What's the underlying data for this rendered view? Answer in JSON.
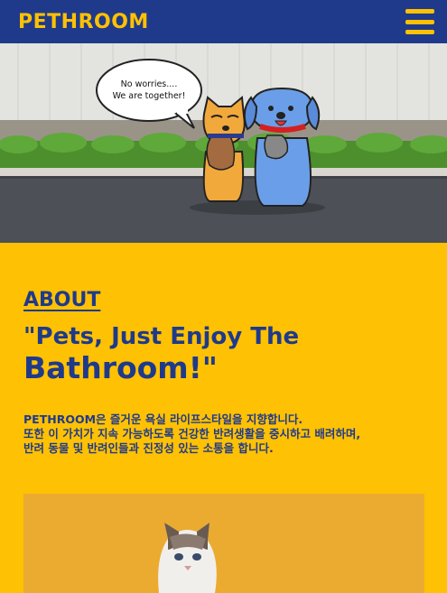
{
  "header": {
    "logo": "PETHROOM"
  },
  "hero": {
    "speech_line1": "No worries....",
    "speech_line2": "We are together!"
  },
  "about": {
    "title": "ABOUT",
    "heading_line1": "\"Pets, Just Enjoy The",
    "heading_line2": "Bathroom!\"",
    "text_lines": [
      "PETHROOM은 즐거운 욕실 라이프스타일을 지향합니다.",
      "또한 이 가치가 지속 가능하도록 건강한 반려생활을 중시하고 배려하며,",
      "반려 동물 및 반려인들과 진정성 있는 소통을 합니다."
    ]
  },
  "colors": {
    "brand_blue": "#1f3a8a",
    "brand_yellow": "#ffc103"
  }
}
